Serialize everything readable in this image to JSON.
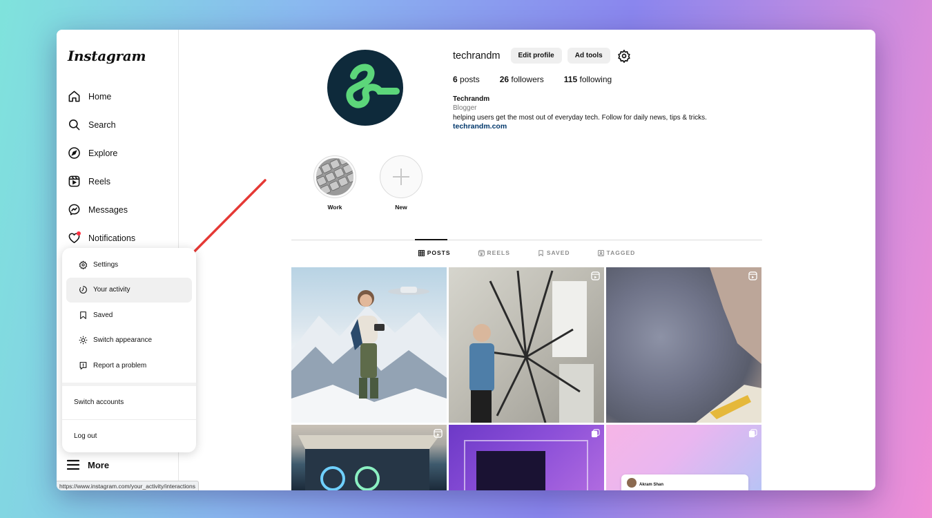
{
  "sidebar": {
    "logo": "Instagram",
    "items": [
      {
        "label": "Home",
        "icon": "home-icon"
      },
      {
        "label": "Search",
        "icon": "search-icon"
      },
      {
        "label": "Explore",
        "icon": "compass-icon"
      },
      {
        "label": "Reels",
        "icon": "reels-icon"
      },
      {
        "label": "Messages",
        "icon": "messenger-icon"
      },
      {
        "label": "Notifications",
        "icon": "heart-icon"
      }
    ],
    "more_label": "More"
  },
  "menu": {
    "items": [
      {
        "label": "Settings",
        "icon": "gear-icon"
      },
      {
        "label": "Your activity",
        "icon": "activity-icon"
      },
      {
        "label": "Saved",
        "icon": "bookmark-icon"
      },
      {
        "label": "Switch appearance",
        "icon": "sun-icon"
      },
      {
        "label": "Report a problem",
        "icon": "report-icon"
      }
    ],
    "switch_accounts": "Switch accounts",
    "logout": "Log out",
    "highlighted": "Your activity"
  },
  "status_url": "https://www.instagram.com/your_activity/interactions",
  "profile": {
    "username": "techrandm",
    "edit_profile": "Edit profile",
    "ad_tools": "Ad tools",
    "posts_count": "6",
    "posts_label": "posts",
    "followers_count": "26",
    "followers_label": "followers",
    "following_count": "115",
    "following_label": "following",
    "display_name": "Techrandm",
    "category": "Blogger",
    "bio": "helping users get the most out of everyday tech. Follow for daily news, tips & tricks.",
    "website": "techrandm.com",
    "avatar_color": "#0e2a3b",
    "logo_color": "#5cd67a"
  },
  "highlights": [
    {
      "label": "Work"
    },
    {
      "label": "New"
    }
  ],
  "tabs": [
    {
      "label": "POSTS",
      "icon": "grid-icon",
      "active": true
    },
    {
      "label": "REELS",
      "icon": "reels-icon",
      "active": false
    },
    {
      "label": "SAVED",
      "icon": "bookmark-icon",
      "active": false
    },
    {
      "label": "TAGGED",
      "icon": "tag-icon",
      "active": false
    }
  ],
  "posts": {
    "p6_name": "Akram Shan"
  }
}
